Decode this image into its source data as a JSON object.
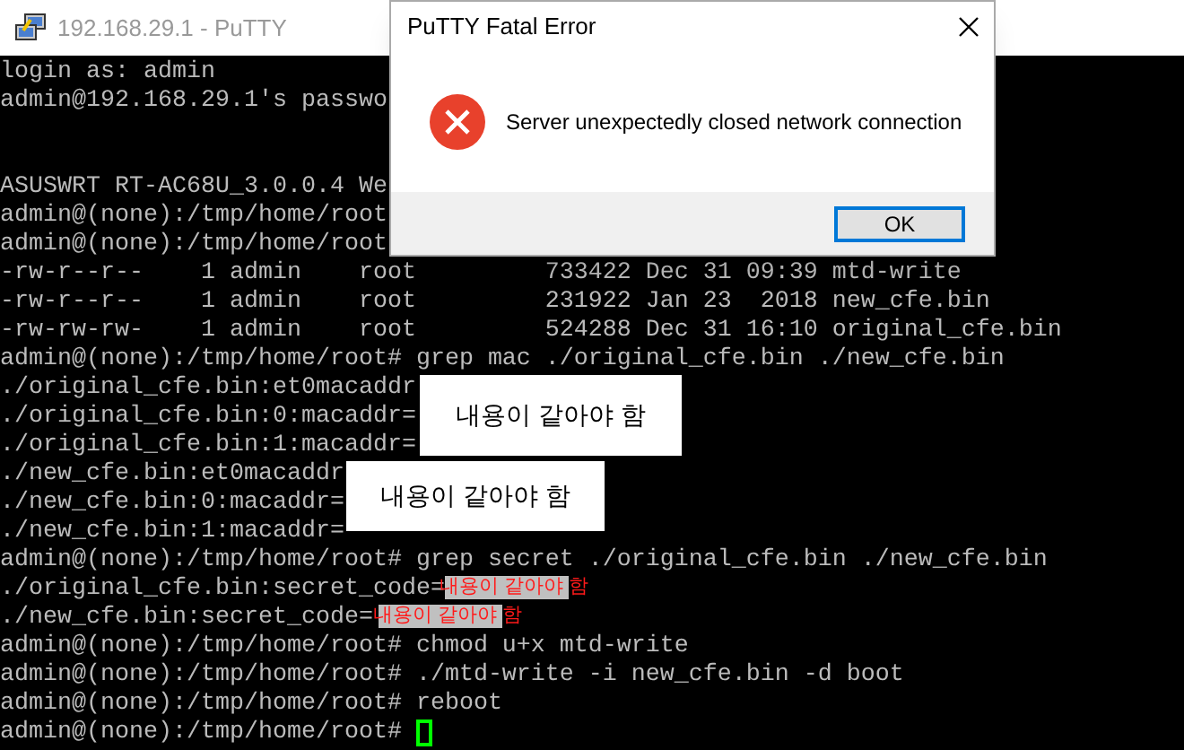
{
  "putty_window": {
    "title": "192.168.29.1 - PuTTY",
    "login_lines": [
      "login as: admin",
      "admin@192.168.29.1's passwo"
    ],
    "terminal_lines": [
      "ASUSWRT RT-AC68U_3.0.0.4 We",
      "admin@(none):/tmp/home/root",
      "admin@(none):/tmp/home/root",
      "-rw-r--r--    1 admin    root         733422 Dec 31 09:39 mtd-write",
      "-rw-r--r--    1 admin    root         231922 Jan 23  2018 new_cfe.bin",
      "-rw-rw-rw-    1 admin    root         524288 Dec 31 16:10 original_cfe.bin",
      "admin@(none):/tmp/home/root# grep mac ./original_cfe.bin ./new_cfe.bin",
      "./original_cfe.bin:et0macaddr",
      "./original_cfe.bin:0:macaddr=",
      "./original_cfe.bin:1:macaddr=",
      "./new_cfe.bin:et0macaddr",
      "./new_cfe.bin:0:macaddr=",
      "./new_cfe.bin:1:macaddr=",
      "admin@(none):/tmp/home/root# grep secret ./original_cfe.bin ./new_cfe.bin",
      "./original_cfe.bin:secret_code=",
      "./new_cfe.bin:secret_code=",
      "admin@(none):/tmp/home/root# chmod u+x mtd-write",
      "admin@(none):/tmp/home/root# ./mtd-write -i new_cfe.bin -d boot",
      "admin@(none):/tmp/home/root# reboot",
      "admin@(none):/tmp/home/root# "
    ]
  },
  "annotations": [
    {
      "kind": "box",
      "text": "내용이 같아야 함"
    },
    {
      "kind": "box",
      "text": "내용이 같아야 함"
    },
    {
      "kind": "highlight",
      "text": "내용이 같아야 함"
    },
    {
      "kind": "highlight",
      "text": "내용이 같아야 함"
    }
  ],
  "dialog": {
    "title": "PuTTY Fatal Error",
    "message": "Server unexpectedly closed network connection",
    "buttons": [
      "OK"
    ]
  }
}
